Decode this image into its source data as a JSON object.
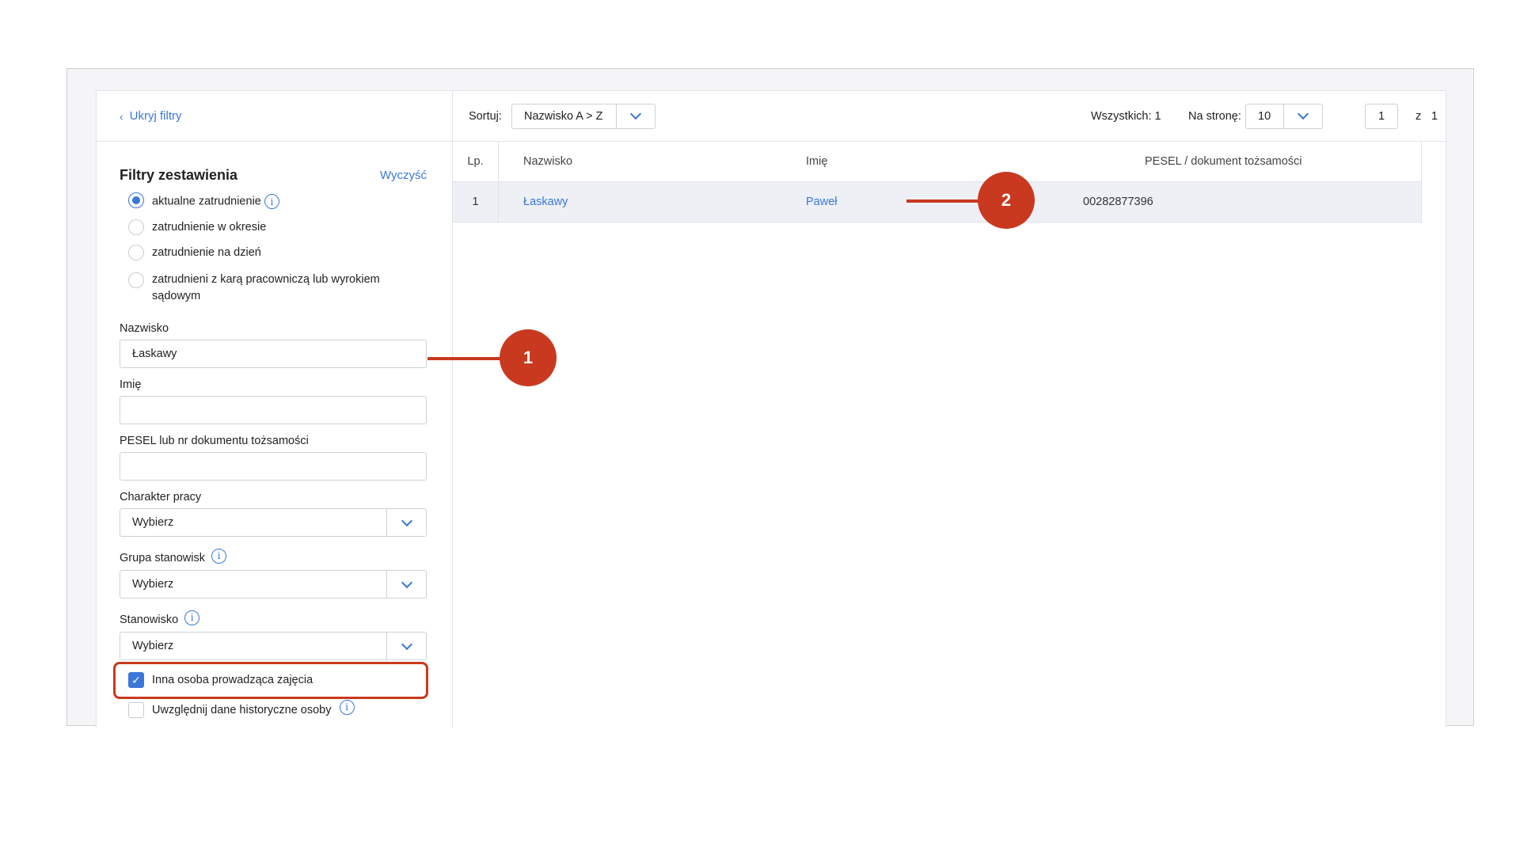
{
  "left": {
    "hide_filters": "Ukryj filtry",
    "title": "Filtry zestawienia",
    "clear": "Wyczyść",
    "radios": [
      {
        "label": "aktualne zatrudnienie",
        "checked": true
      },
      {
        "label": "zatrudnienie w okresie",
        "checked": false
      },
      {
        "label": "zatrudnienie na dzień",
        "checked": false
      },
      {
        "label": "zatrudnieni z karą pracowniczą lub wyrokiem",
        "label2": "sądowym",
        "checked": false
      }
    ],
    "fields": {
      "surname_label": "Nazwisko",
      "surname_value": "Łaskawy",
      "firstname_label": "Imię",
      "firstname_value": "",
      "pesel_label": "PESEL lub nr dokumentu tożsamości",
      "pesel_value": "",
      "work_label": "Charakter pracy",
      "work_value": "Wybierz",
      "group_label": "Grupa stanowisk",
      "group_value": "Wybierz",
      "position_label": "Stanowisko",
      "position_value": "Wybierz"
    },
    "checkboxes": [
      {
        "label": "Inna osoba prowadząca zajęcia",
        "checked": true
      },
      {
        "label": "Uwzględnij dane historyczne osoby",
        "checked": false
      }
    ]
  },
  "topbar": {
    "sort_label": "Sortuj:",
    "sort_value": "Nazwisko A > Z",
    "total": "Wszystkich: 1",
    "perpage_label": "Na stronę:",
    "perpage_value": "10",
    "page_current": "1",
    "page_of": "z",
    "page_total": "1"
  },
  "table": {
    "headers": {
      "lp": "Lp.",
      "surname": "Nazwisko",
      "firstname": "Imię",
      "pesel": "PESEL / dokument tożsamości"
    },
    "rows": [
      {
        "lp": "1",
        "surname": "Łaskawy",
        "firstname": "Paweł",
        "pesel": "00282877396"
      }
    ]
  },
  "annotations": [
    "1",
    "2"
  ],
  "colors": {
    "accent": "#3a77d8",
    "annotation": "#c9391f"
  }
}
